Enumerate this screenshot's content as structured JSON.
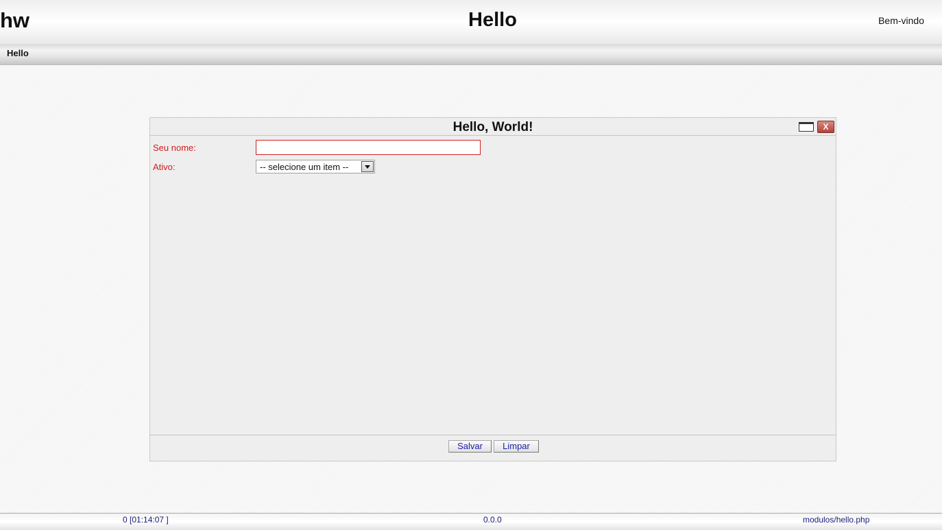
{
  "header": {
    "logo": "hw",
    "title": "Hello",
    "welcome": "Bem-vindo"
  },
  "menu": {
    "items": [
      {
        "label": "Hello"
      }
    ]
  },
  "window": {
    "title": "Hello, World!",
    "close_glyph": "X",
    "form": {
      "name_label": "Seu nome:",
      "name_value": "",
      "active_label": "Ativo:",
      "active_selected": "-- selecione um item --"
    },
    "buttons": {
      "save": "Salvar",
      "clear": "Limpar"
    }
  },
  "status": {
    "left": "0 [01:14:07 ]",
    "center": "0.0.0",
    "right": "modulos/hello.php"
  },
  "colors": {
    "required_label": "#d11a1a",
    "button_text": "#1a1aa8",
    "status_text": "#1a1a7a"
  }
}
